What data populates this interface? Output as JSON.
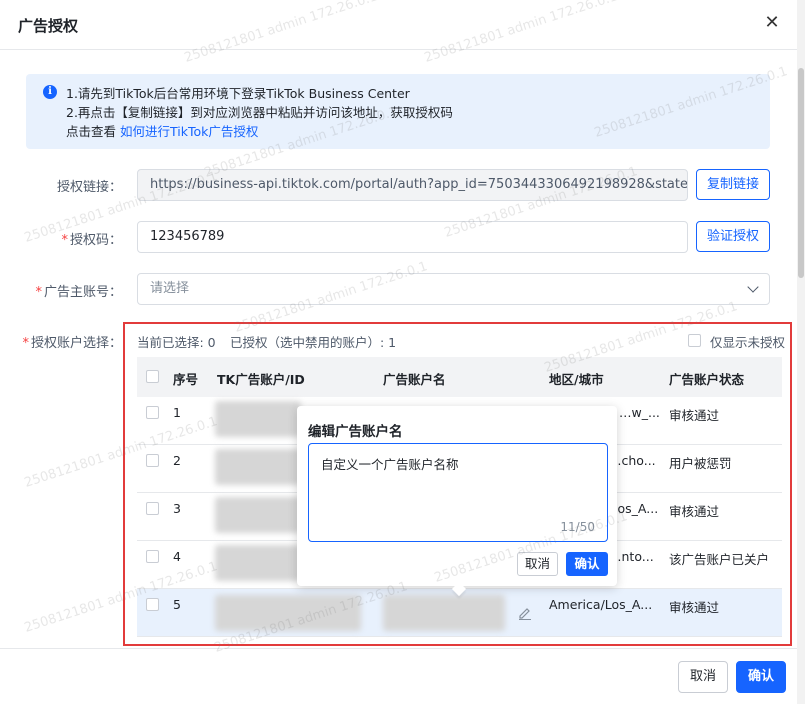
{
  "dialog": {
    "title": "广告授权"
  },
  "notice": {
    "line1": "1.请先到TikTok后台常用环境下登录TikTok Business Center",
    "line2": "2.再点击【复制链接】到对应浏览器中粘贴并访问该地址，获取授权码",
    "line3_prefix": "点击查看",
    "line3_link": "如何进行TikTok广告授权"
  },
  "form": {
    "auth_link_label": "授权链接：",
    "auth_link_value": "https://business-api.tiktok.com/portal/auth?app_id=7503443306492198928&state=8C",
    "copy_button": "复制链接",
    "auth_code_label": "授权码：",
    "auth_code_value": "123456789",
    "verify_button": "验证授权",
    "advertiser_label": "广告主账号：",
    "advertiser_placeholder": "请选择",
    "accounts_label": "授权账户选择："
  },
  "selection": {
    "selected_text": "当前已选择: 0",
    "authorized_text": "已授权（选中禁用的账户）: 1",
    "only_unauthorized": "仅显示未授权"
  },
  "table": {
    "headers": [
      "序号",
      "TK广告账户/ID",
      "广告账户名",
      "地区/城市",
      "广告账户状态"
    ],
    "rows": [
      {
        "idx": "1",
        "region": "…w_...",
        "status": "审核通过"
      },
      {
        "idx": "2",
        "region": "…cho...",
        "status": "用户被惩罚"
      },
      {
        "idx": "3",
        "region": "…os_A...",
        "status": "审核通过"
      },
      {
        "idx": "4",
        "region": "…nto...",
        "status": "该广告账户已关户"
      },
      {
        "idx": "5",
        "region": "America/Los_A...",
        "status": "审核通过"
      }
    ]
  },
  "popover": {
    "title": "编辑广告账户名",
    "text": "自定义一个广告账户名称",
    "count": "11/50",
    "cancel": "取消",
    "ok": "确认"
  },
  "footer": {
    "cancel": "取消",
    "ok": "确认"
  },
  "watermark": "2508121801 admin 172.26.0.1",
  "colors": {
    "primary": "#1664ff",
    "highlight": "#e23b3b"
  }
}
